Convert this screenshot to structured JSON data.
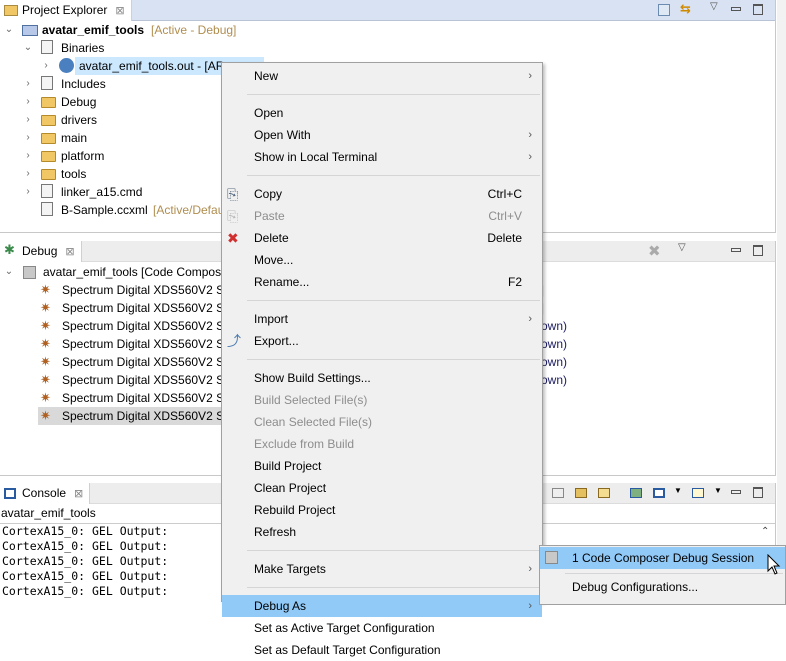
{
  "project_explorer": {
    "tab_label": "Project Explorer",
    "close_glyph": "⊠",
    "tree": [
      {
        "label": "avatar_emif_tools",
        "suffix": "[Active - Debug]",
        "level": 0,
        "expanded": true,
        "icon": "ccs-project-icon"
      },
      {
        "label": "Binaries",
        "level": 1,
        "expanded": true,
        "icon": "binaries-icon"
      },
      {
        "label": "avatar_emif_tools.out - [AR",
        "level": 2,
        "icon": "executable-icon",
        "selected": true
      },
      {
        "label": "Includes",
        "level": 1,
        "icon": "includes-icon"
      },
      {
        "label": "Debug",
        "level": 1,
        "icon": "folder-icon"
      },
      {
        "label": "drivers",
        "level": 1,
        "icon": "folder-icon"
      },
      {
        "label": "main",
        "level": 1,
        "icon": "folder-icon"
      },
      {
        "label": "platform",
        "level": 1,
        "icon": "folder-icon"
      },
      {
        "label": "tools",
        "level": 1,
        "icon": "folder-icon"
      },
      {
        "label": "linker_a15.cmd",
        "level": 1,
        "icon": "file-icon"
      },
      {
        "label": "B-Sample.ccxml",
        "suffix": "[Active/Defau",
        "level": 1,
        "icon": "ccxml-icon"
      }
    ]
  },
  "debug": {
    "tab_label": "Debug",
    "root": "avatar_emif_tools [Code Compos",
    "items": [
      {
        "label": "Spectrum Digital XDS560V2 ST",
        "tail": "|"
      },
      {
        "label": "Spectrum Digital XDS560V2 ST",
        "tail": "|"
      },
      {
        "label": "Spectrum Digital XDS560V2 ST",
        "tail": "own)"
      },
      {
        "label": "Spectrum Digital XDS560V2 ST",
        "tail": "own)"
      },
      {
        "label": "Spectrum Digital XDS560V2 ST",
        "tail": "own)"
      },
      {
        "label": "Spectrum Digital XDS560V2 ST",
        "tail": "own)"
      },
      {
        "label": "Spectrum Digital XDS560V2 ST",
        "tail": ""
      },
      {
        "label": "Spectrum Digital XDS560V2 ST",
        "tail": "",
        "selected": true
      }
    ]
  },
  "console": {
    "tab_label": "Console",
    "title": "avatar_emif_tools",
    "lines": [
      "CortexA15_0: GEL Output:",
      "CortexA15_0: GEL Output:",
      "CortexA15_0: GEL Output:",
      "CortexA15_0: GEL Output:",
      "CortexA15_0: GEL Output:"
    ]
  },
  "context_menu": {
    "items": [
      {
        "label": "New",
        "submenu": true
      },
      {
        "label": "Open"
      },
      {
        "label": "Open With",
        "submenu": true
      },
      {
        "label": "Show in Local Terminal",
        "submenu": true
      },
      {
        "label": "Copy",
        "shortcut": "Ctrl+C",
        "icon": "copy-icon"
      },
      {
        "label": "Paste",
        "shortcut": "Ctrl+V",
        "icon": "paste-icon",
        "disabled": true
      },
      {
        "label": "Delete",
        "shortcut": "Delete",
        "icon": "delete-icon"
      },
      {
        "label": "Move..."
      },
      {
        "label": "Rename...",
        "shortcut": "F2"
      },
      {
        "label": "Import",
        "submenu": true
      },
      {
        "label": "Export...",
        "icon": "export-icon"
      },
      {
        "label": "Show Build Settings..."
      },
      {
        "label": "Build Selected File(s)",
        "disabled": true
      },
      {
        "label": "Clean Selected File(s)",
        "disabled": true
      },
      {
        "label": "Exclude from Build",
        "disabled": true
      },
      {
        "label": "Build Project"
      },
      {
        "label": "Clean Project"
      },
      {
        "label": "Rebuild Project"
      },
      {
        "label": "Refresh"
      },
      {
        "label": "Make Targets",
        "submenu": true
      },
      {
        "label": "Debug As",
        "submenu": true,
        "highlighted": true
      },
      {
        "label": "Set as Active Target Configuration"
      },
      {
        "label": "Set as Default Target Configuration"
      }
    ],
    "submenu_glyph": "›"
  },
  "debug_as_submenu": {
    "items": [
      {
        "label": "1 Code Composer Debug Session",
        "highlighted": true
      },
      {
        "label": "Debug Configurations..."
      }
    ]
  },
  "colors": {
    "highlight": "#91c9f7",
    "selection": "#cce8ff",
    "decoration": "#b08d4f"
  }
}
